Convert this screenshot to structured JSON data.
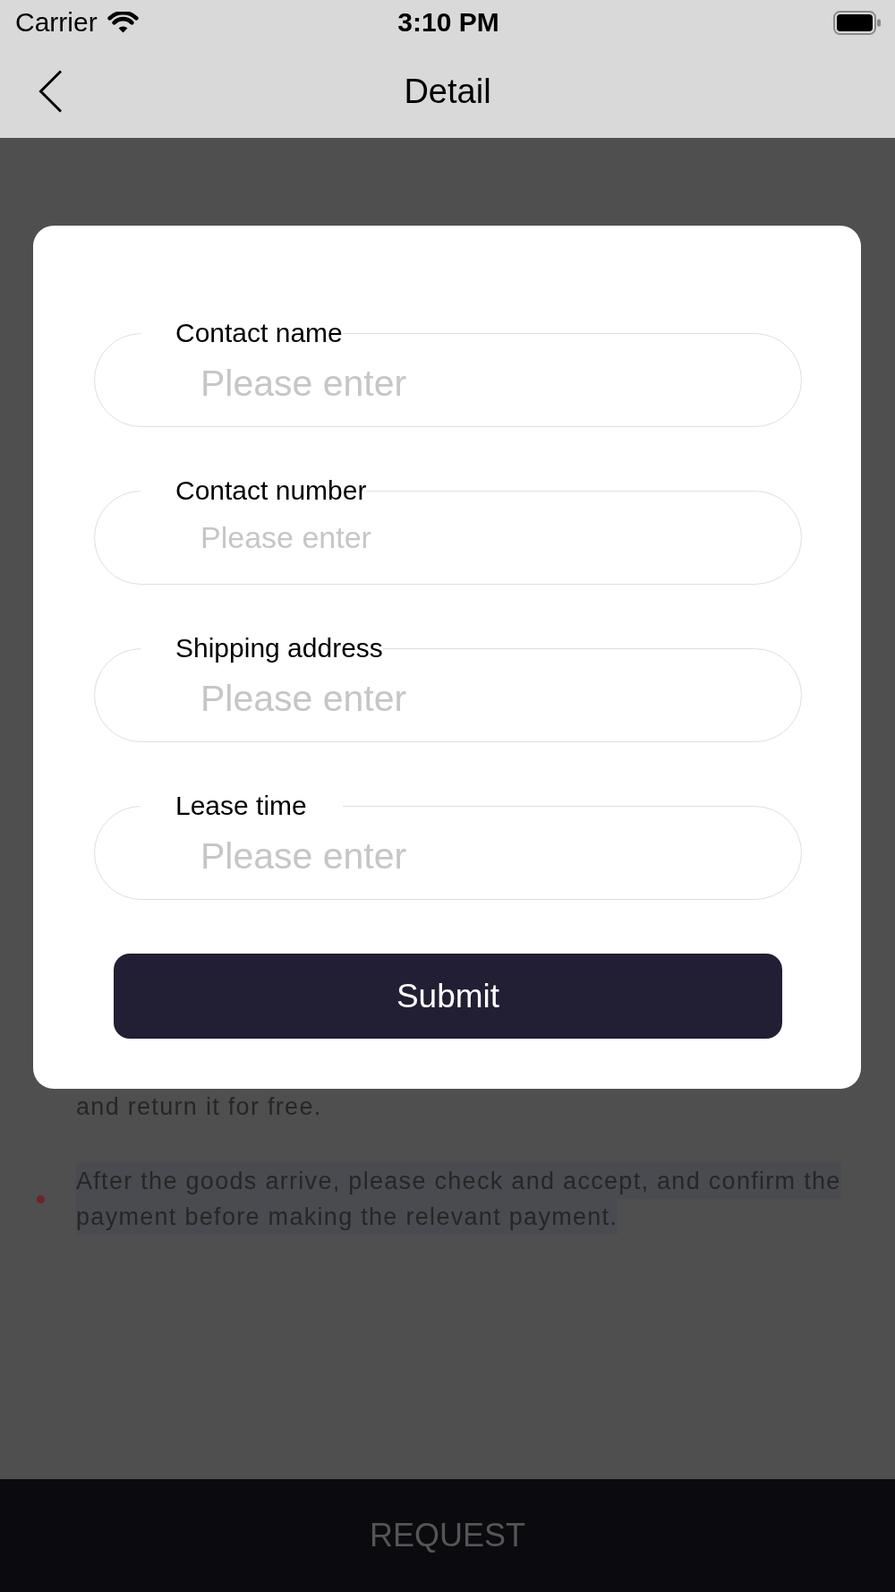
{
  "status_bar": {
    "carrier": "Carrier",
    "time": "3:10 PM"
  },
  "nav_bar": {
    "title": "Detail"
  },
  "background_notes": {
    "continued_text": "and return it for free.",
    "items": [
      {
        "text": "After the goods arrive, please check and accept, and confirm the payment before making the relevant payment."
      }
    ]
  },
  "dialog": {
    "fields": [
      {
        "label": "Contact name",
        "placeholder": "Please enter"
      },
      {
        "label": "Contact number",
        "placeholder": "Please enter"
      },
      {
        "label": "Shipping address",
        "placeholder": "Please enter"
      },
      {
        "label": "Lease time",
        "placeholder": "Please enter"
      }
    ],
    "submit_button": "Submit"
  },
  "bottom_bar": {
    "button": "REQUEST"
  }
}
